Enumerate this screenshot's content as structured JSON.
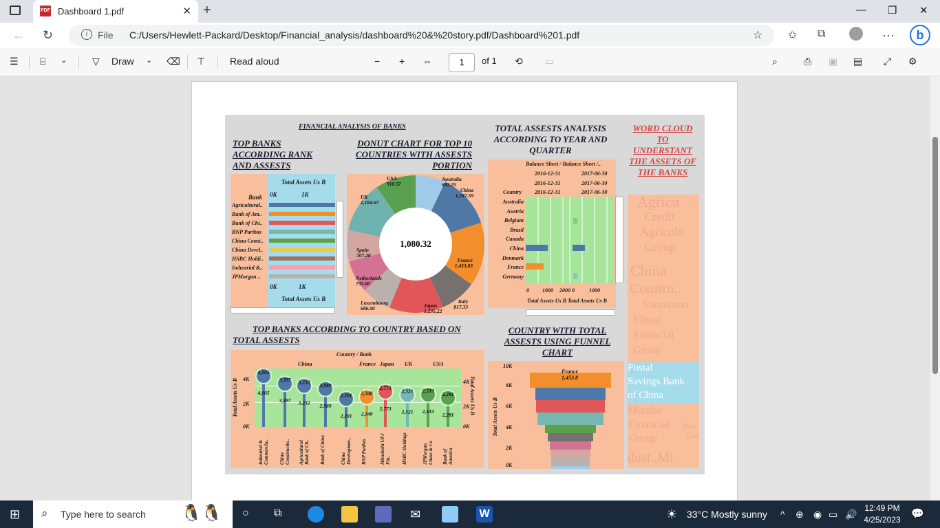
{
  "browser": {
    "tab_title": "Dashboard 1.pdf",
    "file_label": "File",
    "url": "C:/Users/Hewlett-Packard/Desktop/Financial_analysis/dashboard%20&%20story.pdf/Dashboard%201.pdf"
  },
  "pdf_toolbar": {
    "draw": "Draw",
    "read_aloud": "Read aloud",
    "page": "1",
    "of_pages": "of 1"
  },
  "dashboard": {
    "title": "FINANCIAL ANALYSIS OF BANKS",
    "top_banks_title": "TOP BANKS ACCORDING RANK AND ASSESTS",
    "donut_title": "DONUT CHART FOR TOP 10 COUNTRIES WITH ASSESTS PORTION",
    "total_assets_title": "TOTAL ASSESTS ANALYSIS ACCORDING TO YEAR AND QUARTER",
    "wordcloud_title": "WORD CLOUD TO UNDERSTANT THE ASSETS OF THE BANKS",
    "country_title": "TOP BANKS ACCORDING TO COUNTRY BASED ON TOTAL ASSESTS",
    "funnel_title": "COUNTRY WITH TOTAL ASSESTS USING FUNNEL CHART"
  },
  "bank_bars": {
    "header": "Total Assets Us B",
    "bank_col": "Bank",
    "ticks": [
      "0K",
      "1K"
    ],
    "footer": "Total Assets Us B",
    "banks": [
      "Agricultural..",
      "Bank of Am..",
      "Bank of Chi..",
      "BNP Paribas",
      "China Const..",
      "China Devel..",
      "HSBC Holdi..",
      "Industrial &..",
      "JPMorgan .."
    ],
    "colors": [
      "#4e79a7",
      "#f28e2b",
      "#e15759",
      "#76b7b2",
      "#59a14f",
      "#edc948",
      "#9c755f",
      "#ff9da7",
      "#bab0ac"
    ]
  },
  "donut": {
    "center": "1,080.32",
    "labels": [
      {
        "name": "Australia",
        "value": "682.25"
      },
      {
        "name": "China",
        "value": "1,247.59"
      },
      {
        "name": "France",
        "value": "1,453.83"
      },
      {
        "name": "Italy",
        "value": "817.33"
      },
      {
        "name": "Japan",
        "value": "1,235.22"
      },
      {
        "name": "Luxembourg",
        "value": "686.00"
      },
      {
        "name": "Netherlands",
        "value": "735.00"
      },
      {
        "name": "Spain",
        "value": "707.20"
      },
      {
        "name": "UK",
        "value": "1,184.67"
      },
      {
        "name": "USA",
        "value": "918.57"
      }
    ]
  },
  "heatmap": {
    "header": "Balance Sheet / Balance Sheet /..",
    "dates_left": [
      "2016-12-31",
      "2016-12-31",
      "2016-12-31"
    ],
    "dates_right": [
      "2017-06-30",
      "2017-06-30",
      "2017-06-30"
    ],
    "country_lbl": "Country",
    "countries": [
      "Australia",
      "Austria",
      "Belgium",
      "Brazil",
      "Canada",
      "China",
      "Denmark",
      "France",
      "Germany"
    ],
    "ticks": [
      "0",
      "1000",
      "2000 0",
      "1000"
    ],
    "footer": "Total Assets Us B  Total Assets Us B"
  },
  "wordcloud": {
    "words": [
      "Agricu",
      "Credit",
      "Agricole",
      "Group",
      "China",
      "Constru..",
      "Sumitomo",
      "Mitsui",
      "Financial",
      "Group",
      "Postal",
      "Savings Bank",
      "of China",
      "Mizuho",
      "Financial",
      "Group",
      "Roy",
      "Can",
      "dust..Mi"
    ]
  },
  "lollipop": {
    "header": "Country / Bank",
    "countries": [
      "China",
      "France",
      "Japan",
      "UK",
      "USA"
    ],
    "yticks": [
      "4K",
      "2K",
      "0K"
    ],
    "ylabel": "Total Assets Us B",
    "values": [
      "4,005",
      "3,397",
      "3,232",
      "2,989",
      "2,201",
      "2,348",
      "2,773",
      "2,521",
      "2,533",
      "2,281"
    ],
    "banks": [
      "Industrial & Commercia..",
      "China Constructio..",
      "Agricultural Bank of Ch..",
      "Bank of China",
      "China Developmen..",
      "BNP Paribas",
      "Mitsubishi UFJ Fin..",
      "HSBC Holdings",
      "JPMorgan Chase & Co",
      "Bank of America"
    ]
  },
  "funnel": {
    "yticks": [
      "10K",
      "8K",
      "6K",
      "4K",
      "2K",
      "0K"
    ],
    "ylabel": "Total Assets Us B",
    "top_label": "France",
    "top_value": "1,453.8"
  },
  "taskbar": {
    "search": "Type here to search",
    "weather": "33°C  Mostly sunny",
    "time": "12:49 PM",
    "date": "4/25/2023",
    "notif": "1"
  }
}
